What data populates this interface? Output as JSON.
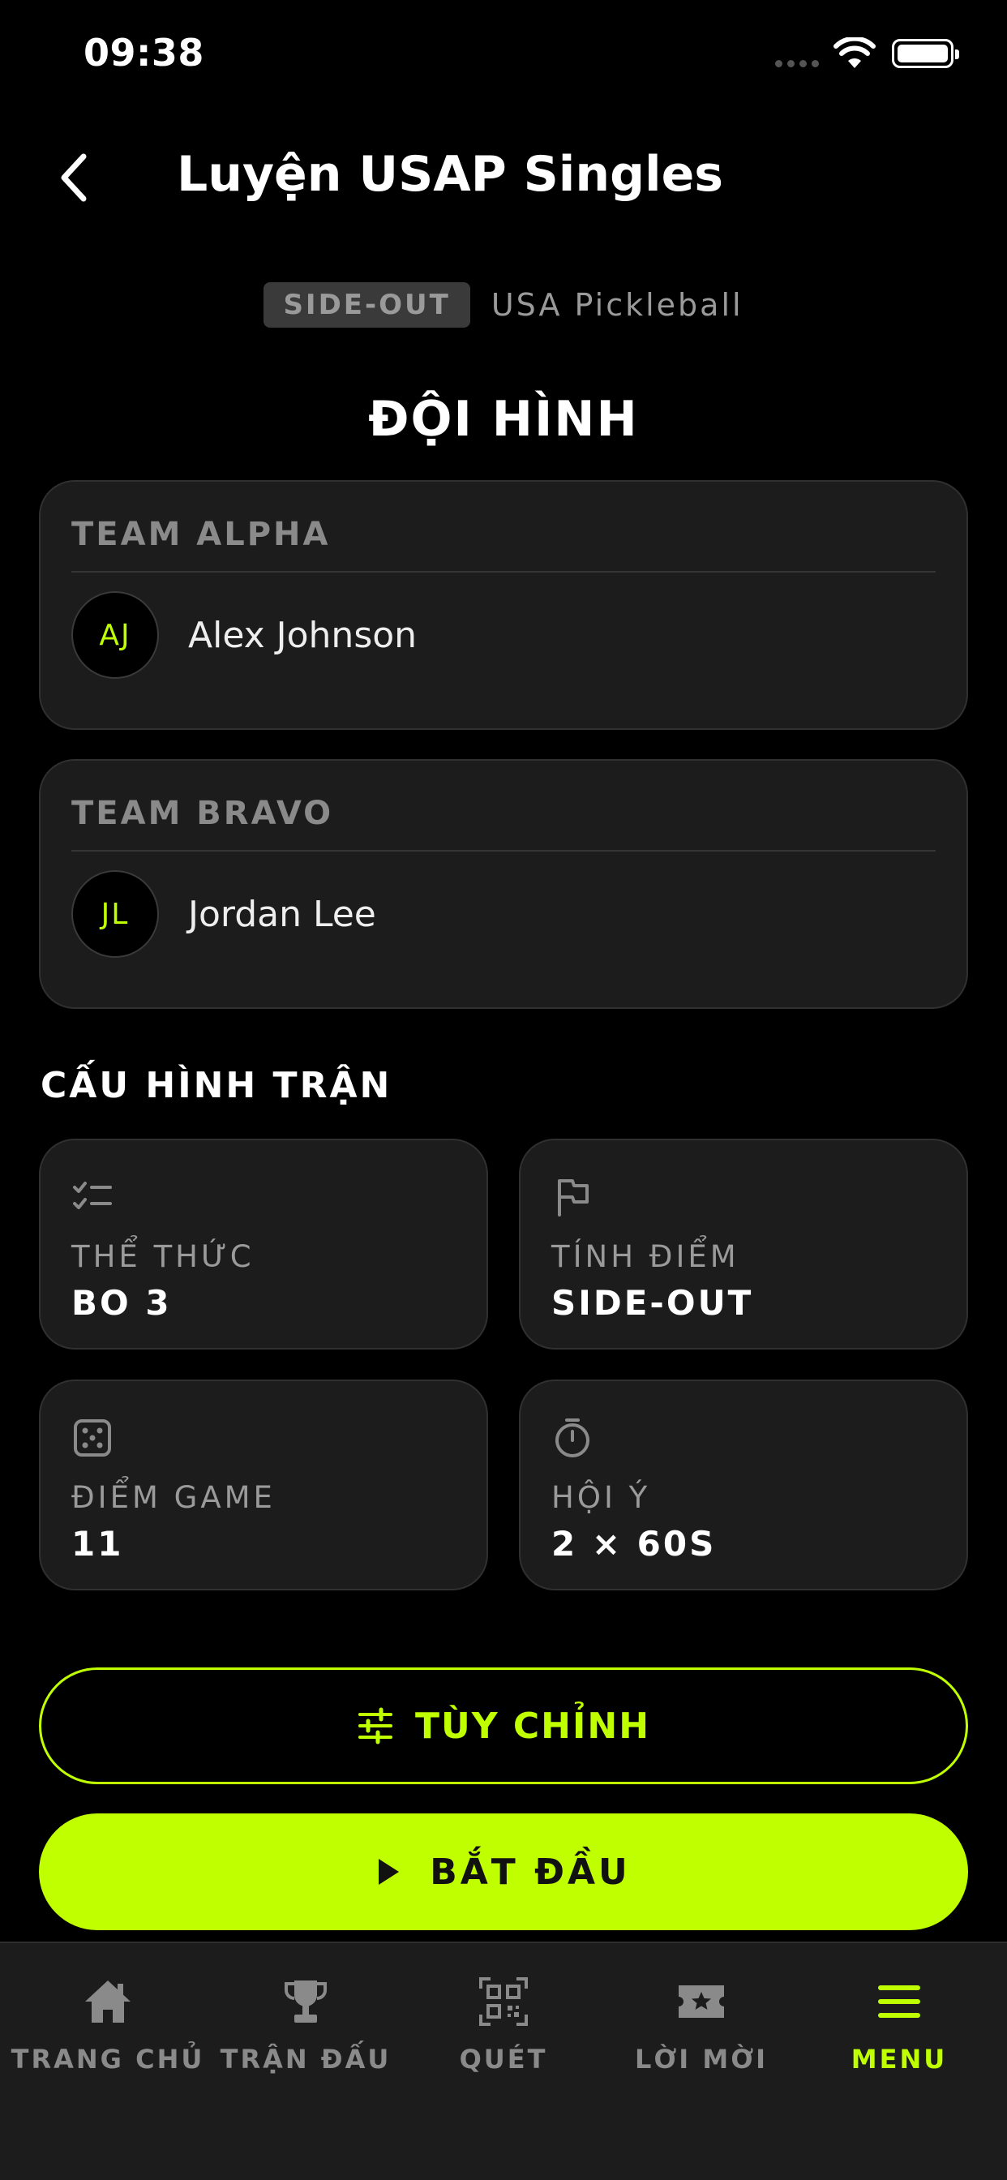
{
  "status_bar": {
    "time": "09:38"
  },
  "header": {
    "title": "Luyện USAP Singles"
  },
  "mode": {
    "badge": "SIDE-OUT",
    "org": "USA Pickleball"
  },
  "lineup": {
    "title": "ĐỘI HÌNH",
    "teams": [
      {
        "name": "TEAM ALPHA",
        "player_initials": "AJ",
        "player_name": "Alex Johnson"
      },
      {
        "name": "TEAM BRAVO",
        "player_initials": "JL",
        "player_name": "Jordan Lee"
      }
    ]
  },
  "config": {
    "title": "CẤU HÌNH TRẬN",
    "items": [
      {
        "icon": "checklist-icon",
        "label": "THỂ THỨC",
        "value": "BO 3"
      },
      {
        "icon": "flag-icon",
        "label": "TÍNH ĐIỂM",
        "value": "SIDE-OUT"
      },
      {
        "icon": "dice-icon",
        "label": "ĐIỂM GAME",
        "value": "11"
      },
      {
        "icon": "stopwatch-icon",
        "label": "HỘI Ý",
        "value": "2 × 60S"
      }
    ]
  },
  "actions": {
    "customize_label": "TÙY CHỈNH",
    "start_label": "BẮT ĐẦU"
  },
  "tabbar": {
    "tabs": [
      {
        "icon": "home-icon",
        "label": "TRANG CHỦ",
        "active": false
      },
      {
        "icon": "trophy-icon",
        "label": "TRẬN ĐẤU",
        "active": false
      },
      {
        "icon": "qr-icon",
        "label": "QUÉT",
        "active": false
      },
      {
        "icon": "ticket-icon",
        "label": "LỜI MỜI",
        "active": false
      },
      {
        "icon": "menu-icon",
        "label": "MENU",
        "active": true
      }
    ]
  },
  "colors": {
    "accent": "#bfff00",
    "card": "#1c1c1c",
    "background": "#000000"
  }
}
